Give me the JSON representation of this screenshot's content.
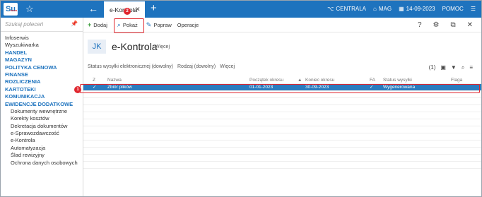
{
  "app": {
    "logo": "Su",
    "logo_small": "nova"
  },
  "tabs": {
    "active": "e-Kontrola"
  },
  "topbar": {
    "branch": "CENTRALA",
    "warehouse": "MAG",
    "date": "14-09-2023",
    "help": "POMOC"
  },
  "sidebar": {
    "search_placeholder": "Szukaj poleceń",
    "items": [
      {
        "label": "Infoserwis",
        "type": "plain"
      },
      {
        "label": "Wyszukiwarka",
        "type": "plain"
      },
      {
        "label": "HANDEL",
        "type": "cat"
      },
      {
        "label": "MAGAZYN",
        "type": "cat"
      },
      {
        "label": "POLITYKA CENOWA",
        "type": "cat"
      },
      {
        "label": "FINANSE",
        "type": "cat"
      },
      {
        "label": "ROZLICZENIA",
        "type": "cat"
      },
      {
        "label": "KARTOTEKI",
        "type": "cat"
      },
      {
        "label": "KOMUNIKACJA",
        "type": "cat"
      },
      {
        "label": "EWIDENCJE DODATKOWE",
        "type": "cat"
      },
      {
        "label": "Dokumenty wewnętrzne",
        "type": "sub"
      },
      {
        "label": "Korekty kosztów",
        "type": "sub"
      },
      {
        "label": "Dekretacja dokumentów",
        "type": "sub"
      },
      {
        "label": "e-Sprawozdawczość",
        "type": "sub"
      },
      {
        "label": "e-Kontrola",
        "type": "sub"
      },
      {
        "label": "Automatyzacja",
        "type": "sub"
      },
      {
        "label": "Ślad rewizyjny",
        "type": "sub"
      },
      {
        "label": "Ochrona danych osobowych",
        "type": "sub"
      }
    ]
  },
  "toolbar": {
    "add": "Dodaj",
    "show": "Pokaż",
    "edit": "Popraw",
    "ops": "Operacje"
  },
  "page": {
    "badge": "JK",
    "title": "e-Kontrola",
    "more": "Więcej"
  },
  "filters": {
    "status": "Status wysyłki elektronicznej (dowolny)",
    "kind": "Rodzaj (dowolny)",
    "more": "Więcej",
    "count": "(1)"
  },
  "grid": {
    "headers": {
      "z": "Z",
      "name": "Nazwa",
      "start": "Początek okresu",
      "end": "Koniec okresu",
      "fa": "FA",
      "status": "Status wysyłki",
      "flag": "Flaga"
    },
    "rows": [
      {
        "z": "✓",
        "name": "Zbiór plików",
        "start": "01-01-2023",
        "end": "30-09-2023",
        "fa": "✓",
        "status": "Wygenerowana",
        "flag": ""
      }
    ]
  },
  "badges": {
    "one": "1",
    "two": "2"
  },
  "colors": {
    "brand": "#1e73be",
    "highlight": "#e0262e",
    "selected_row": "#2a7bbf"
  }
}
